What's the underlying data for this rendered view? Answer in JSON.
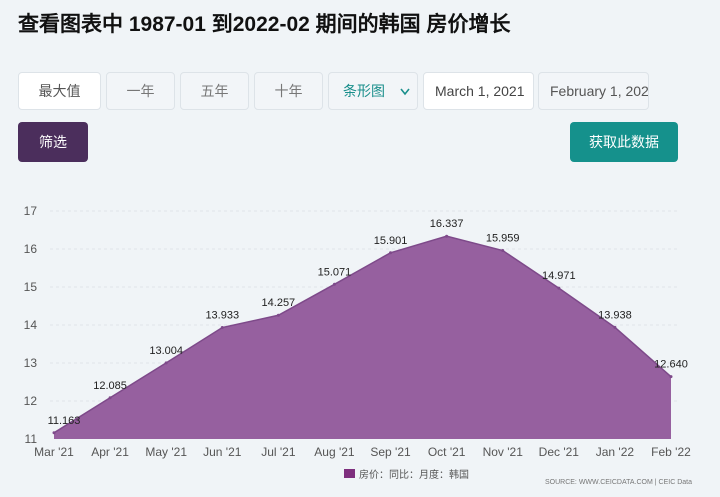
{
  "title": "查看图表中 1987-01 到2022-02 期间的韩国 房价增长",
  "range_buttons": [
    "最大值",
    "一年",
    "五年",
    "十年"
  ],
  "chart_type_select": "条形图",
  "date_from": "March 1, 2021",
  "date_to": "February 1, 202",
  "filter_label": "筛选",
  "get_data_label": "获取此数据",
  "colors": {
    "series": "#96609f",
    "line": "#7e4a8a",
    "filter": "#4b2e5c",
    "get_data": "#15918c",
    "select_text": "#1a8f8c"
  },
  "icons": {
    "select": "chevron-down-icon"
  },
  "chart_data": {
    "type": "area",
    "x": [
      "Mar '21",
      "Apr '21",
      "May '21",
      "Jun '21",
      "Jul '21",
      "Aug '21",
      "Sep '21",
      "Oct '21",
      "Nov '21",
      "Dec '21",
      "Jan '22",
      "Feb '22"
    ],
    "series": [
      {
        "name": "房价：同比：月度：韩国",
        "values": [
          11.163,
          12.085,
          13.004,
          13.933,
          14.257,
          15.071,
          15.901,
          16.337,
          15.959,
          14.971,
          13.938,
          12.64
        ]
      }
    ],
    "value_labels": [
      "11.163",
      "12.085",
      "13.004",
      "13.933",
      "14.257",
      "15.071",
      "15.901",
      "16.337",
      "15.959",
      "14.971",
      "13.938",
      "12.640"
    ],
    "yticks": [
      "11",
      "12",
      "13",
      "14",
      "15",
      "16",
      "17"
    ],
    "ylim": [
      11,
      17
    ],
    "grid": true,
    "legend_position": "bottom",
    "source": "SOURCE: WWW.CEICDATA.COM | CEIC Data"
  }
}
